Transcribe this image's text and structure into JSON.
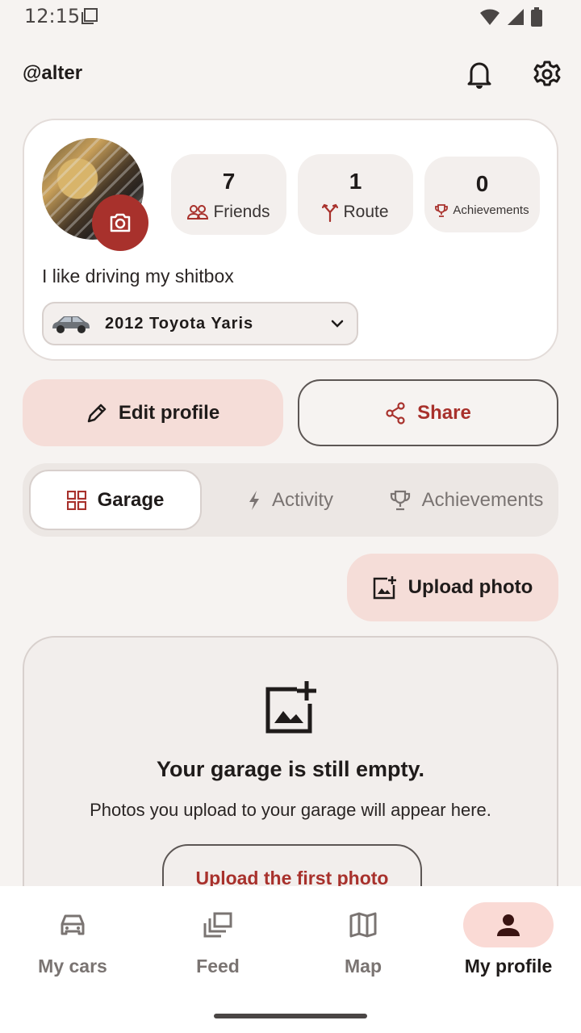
{
  "status_bar": {
    "time": "12:15",
    "icons": [
      "screenshot-icon",
      "wifi-icon",
      "signal-icon",
      "battery-icon"
    ]
  },
  "header": {
    "handle": "@alter",
    "icons": [
      "bell-icon",
      "gear-icon"
    ]
  },
  "profile": {
    "avatar_icon": "camera-icon",
    "stats": [
      {
        "value": "7",
        "label": "Friends",
        "icon": "people-icon"
      },
      {
        "value": "1",
        "label": "Route",
        "icon": "route-icon"
      },
      {
        "value": "0",
        "label": "Achievements",
        "icon": "trophy-icon"
      }
    ],
    "bio": "I like driving my shitbox",
    "car": {
      "name": "2012 Toyota Yaris",
      "icon": "chevron-down-icon"
    }
  },
  "actions": {
    "edit_label": "Edit profile",
    "share_label": "Share"
  },
  "tabs": [
    {
      "label": "Garage",
      "icon": "grid-icon",
      "selected": true
    },
    {
      "label": "Activity",
      "icon": "bolt-icon",
      "selected": false
    },
    {
      "label": "Achievements",
      "icon": "trophy-icon",
      "selected": false
    }
  ],
  "upload": {
    "label": "Upload photo",
    "icon": "add-photo-icon"
  },
  "empty_state": {
    "title": "Your garage is still empty.",
    "subtitle": "Photos you upload to your garage will appear here.",
    "button_label": "Upload the first photo"
  },
  "bottom_nav": [
    {
      "label": "My cars",
      "icon": "car-icon",
      "active": false
    },
    {
      "label": "Feed",
      "icon": "feed-icon",
      "active": false
    },
    {
      "label": "Map",
      "icon": "map-icon",
      "active": false
    },
    {
      "label": "My profile",
      "icon": "person-icon",
      "active": true
    }
  ],
  "colors": {
    "accent": "#a8312c",
    "tonal": "#f5ddd8",
    "background": "#f6f3f1"
  }
}
